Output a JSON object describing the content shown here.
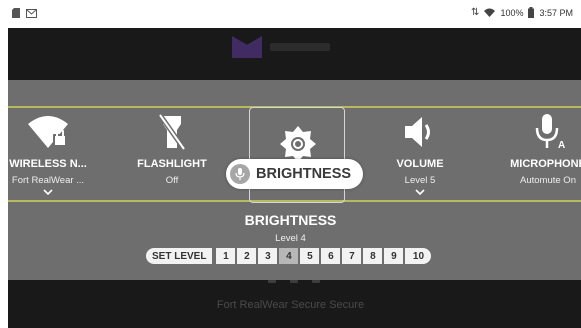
{
  "status_bar": {
    "left_icons": [
      "sim-card-icon",
      "mail-icon"
    ],
    "battery_percent": "100%",
    "time": "3:57 PM",
    "icons": [
      "wifi-icon",
      "battery-icon"
    ]
  },
  "background_app": {
    "footer_text": "Fort RealWear Secure Secure"
  },
  "carousel": {
    "items": [
      {
        "title": "WIRELESS N...",
        "subtitle": "Fort RealWear ...",
        "icon": "wifi-lock-icon",
        "has_dropdown": true
      },
      {
        "title": "FLASHLIGHT",
        "subtitle": "Off",
        "icon": "flashlight-off-icon",
        "has_dropdown": false
      },
      {
        "title": "BRIGHTNESS",
        "subtitle": "",
        "icon": "brightness-icon",
        "selected": true
      },
      {
        "title": "VOLUME",
        "subtitle": "Level 5",
        "icon": "volume-icon",
        "has_dropdown": true
      },
      {
        "title": "MICROPHONE",
        "subtitle": "Automute On",
        "icon": "microphone-icon",
        "has_dropdown": false
      }
    ],
    "selected_pill": "BRIGHTNESS"
  },
  "detail": {
    "title": "BRIGHTNESS",
    "subtitle": "Level 4",
    "set_level_label": "SET LEVEL",
    "levels": [
      "1",
      "2",
      "3",
      "4",
      "5",
      "6",
      "7",
      "8",
      "9",
      "10"
    ],
    "active_level": "4"
  },
  "colors": {
    "overlay": "#6e6e6e",
    "carousel_border": "#b9b95e",
    "app_background": "#191919",
    "logo_accent": "#5b3a93"
  }
}
